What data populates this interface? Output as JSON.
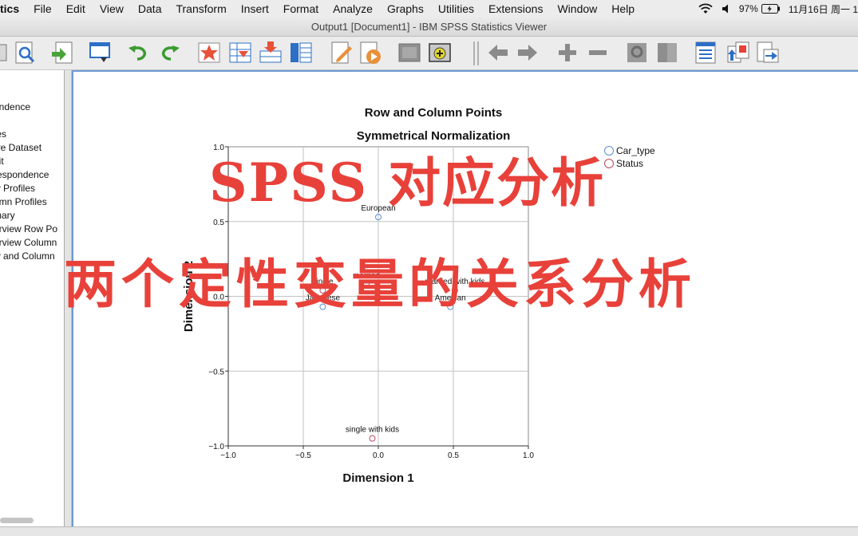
{
  "menubar": {
    "items": [
      "tics",
      "File",
      "Edit",
      "View",
      "Data",
      "Transform",
      "Insert",
      "Format",
      "Analyze",
      "Graphs",
      "Utilities",
      "Extensions",
      "Window",
      "Help"
    ],
    "battery": "97%",
    "datetime": "11月16日 周一  1"
  },
  "window": {
    "title": "Output1 [Document1] - IBM SPSS Statistics Viewer"
  },
  "outline": {
    "items": [
      "ondence",
      "e",
      "tes",
      "ive Dataset",
      "dit",
      "respondence",
      "w Profiles",
      "umn Profiles",
      "mary",
      "erview Row Po",
      "erview Column",
      "w and Column"
    ]
  },
  "overlay": {
    "line1": "SPSS 对应分析",
    "line2": "两个定性变量的关系分析"
  },
  "chart_data": {
    "type": "scatter",
    "title": "Row and Column Points",
    "subtitle": "Symmetrical Normalization",
    "xlabel": "Dimension 1",
    "ylabel": "Dimension 2",
    "xlim": [
      -1.0,
      1.0
    ],
    "ylim": [
      -1.0,
      1.0
    ],
    "xticks": [
      -1.0,
      -0.5,
      0.0,
      0.5,
      1.0
    ],
    "yticks": [
      -1.0,
      -0.5,
      0.0,
      0.5,
      1.0
    ],
    "xtick_labels": [
      "−1.0",
      "−0.5",
      "0.0",
      "0.5",
      "1.0"
    ],
    "ytick_labels": [
      "−1.0",
      "−0.5",
      "0.0",
      "0.5",
      "1.0"
    ],
    "grid": true,
    "legend_position": "top-right",
    "series": [
      {
        "name": "Car_type",
        "color": "#5b8fd6",
        "points": [
          {
            "label": "European",
            "x": 0.0,
            "y": 0.53
          },
          {
            "label": "Japanese",
            "x": -0.37,
            "y": -0.07
          },
          {
            "label": "Ameican",
            "x": 0.48,
            "y": -0.07
          }
        ]
      },
      {
        "name": "Status",
        "color": "#b54a5e",
        "points": [
          {
            "label": "single",
            "x": -0.37,
            "y": 0.04
          },
          {
            "label": "married",
            "x": -0.08,
            "y": 0.08
          },
          {
            "label": "married with kids",
            "x": 0.51,
            "y": 0.04
          },
          {
            "label": "single with kids",
            "x": -0.04,
            "y": -0.95
          }
        ]
      }
    ]
  }
}
